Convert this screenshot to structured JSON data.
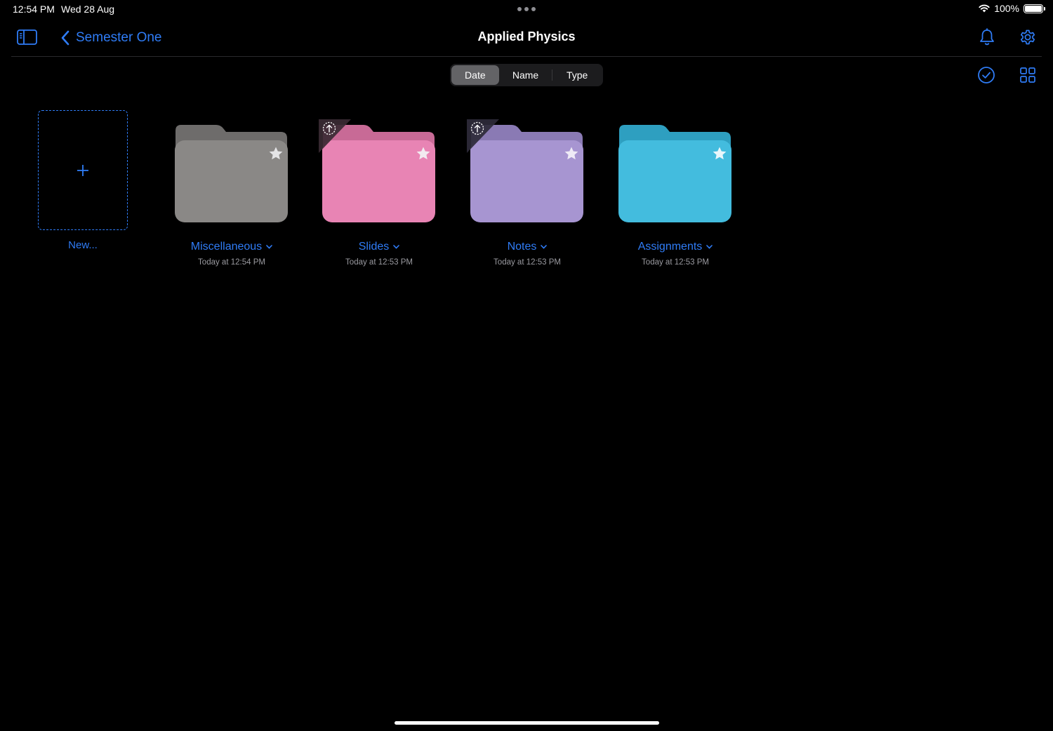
{
  "status_bar": {
    "time": "12:54 PM",
    "date": "Wed 28 Aug",
    "battery": "100%",
    "battery_level": 1.0,
    "icons": [
      "wifi-icon",
      "battery-icon"
    ]
  },
  "nav": {
    "back_label": "Semester One",
    "title": "Applied Physics",
    "icons": [
      "sidebar-toggle-icon",
      "chevron-left-icon",
      "bell-icon",
      "gear-icon"
    ]
  },
  "sort": {
    "options": [
      "Date",
      "Name",
      "Type"
    ],
    "selected": "Date"
  },
  "toolbar_icons": [
    "select-checkmark-icon",
    "grid-view-icon"
  ],
  "new_item": {
    "label": "New...",
    "icon": "plus-icon"
  },
  "folders": [
    {
      "name": "Miscellaneous",
      "modified": "Today at 12:54 PM",
      "color": "#8a8886",
      "tab_color": "#6e6c6b",
      "starred": true,
      "uploading": false
    },
    {
      "name": "Slides",
      "modified": "Today at 12:53 PM",
      "color": "#e884b4",
      "tab_color": "#c86a96",
      "starred": true,
      "uploading": true
    },
    {
      "name": "Notes",
      "modified": "Today at 12:53 PM",
      "color": "#a795d1",
      "tab_color": "#8a7ab4",
      "starred": true,
      "uploading": true
    },
    {
      "name": "Assignments",
      "modified": "Today at 12:53 PM",
      "color": "#43bcde",
      "tab_color": "#2e9fc0",
      "starred": true,
      "uploading": false
    }
  ],
  "colors": {
    "accent": "#2f7cf6",
    "background": "#000000",
    "secondary_text": "#9a9aa0"
  }
}
